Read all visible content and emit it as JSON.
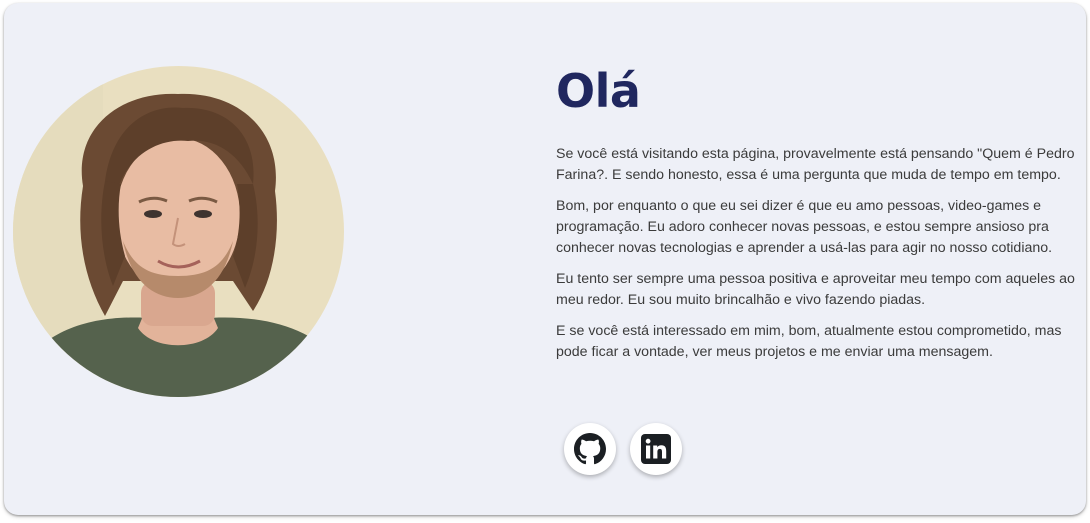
{
  "profile": {
    "photo_alt": "Pedro Farina"
  },
  "intro": {
    "title": "Olá",
    "paragraphs": [
      "Se você está visitando esta página, provavelmente está pensando \"Quem é Pedro Farina?. E sendo honesto, essa é uma pergunta que muda de tempo em tempo.",
      "Bom, por enquanto o que eu sei dizer é que eu amo pessoas, video-games e programação. Eu adoro conhecer novas pessoas, e estou sempre ansioso pra conhecer novas tecnologias e aprender a usá-las para agir no nosso cotidiano.",
      "Eu tento ser sempre uma pessoa positiva e aproveitar meu tempo com aqueles ao meu redor. Eu sou muito brincalhão e vivo fazendo piadas.",
      "E se você está interessado em mim, bom, atualmente estou comprometido, mas pode ficar a vontade, ver meus projetos e me enviar uma mensagem."
    ]
  },
  "socials": [
    {
      "icon": "github-icon"
    },
    {
      "icon": "linkedin-icon"
    }
  ],
  "colors": {
    "card_background": "#eef0f7",
    "title": "#20275f",
    "body_text": "#3b3b3b"
  }
}
